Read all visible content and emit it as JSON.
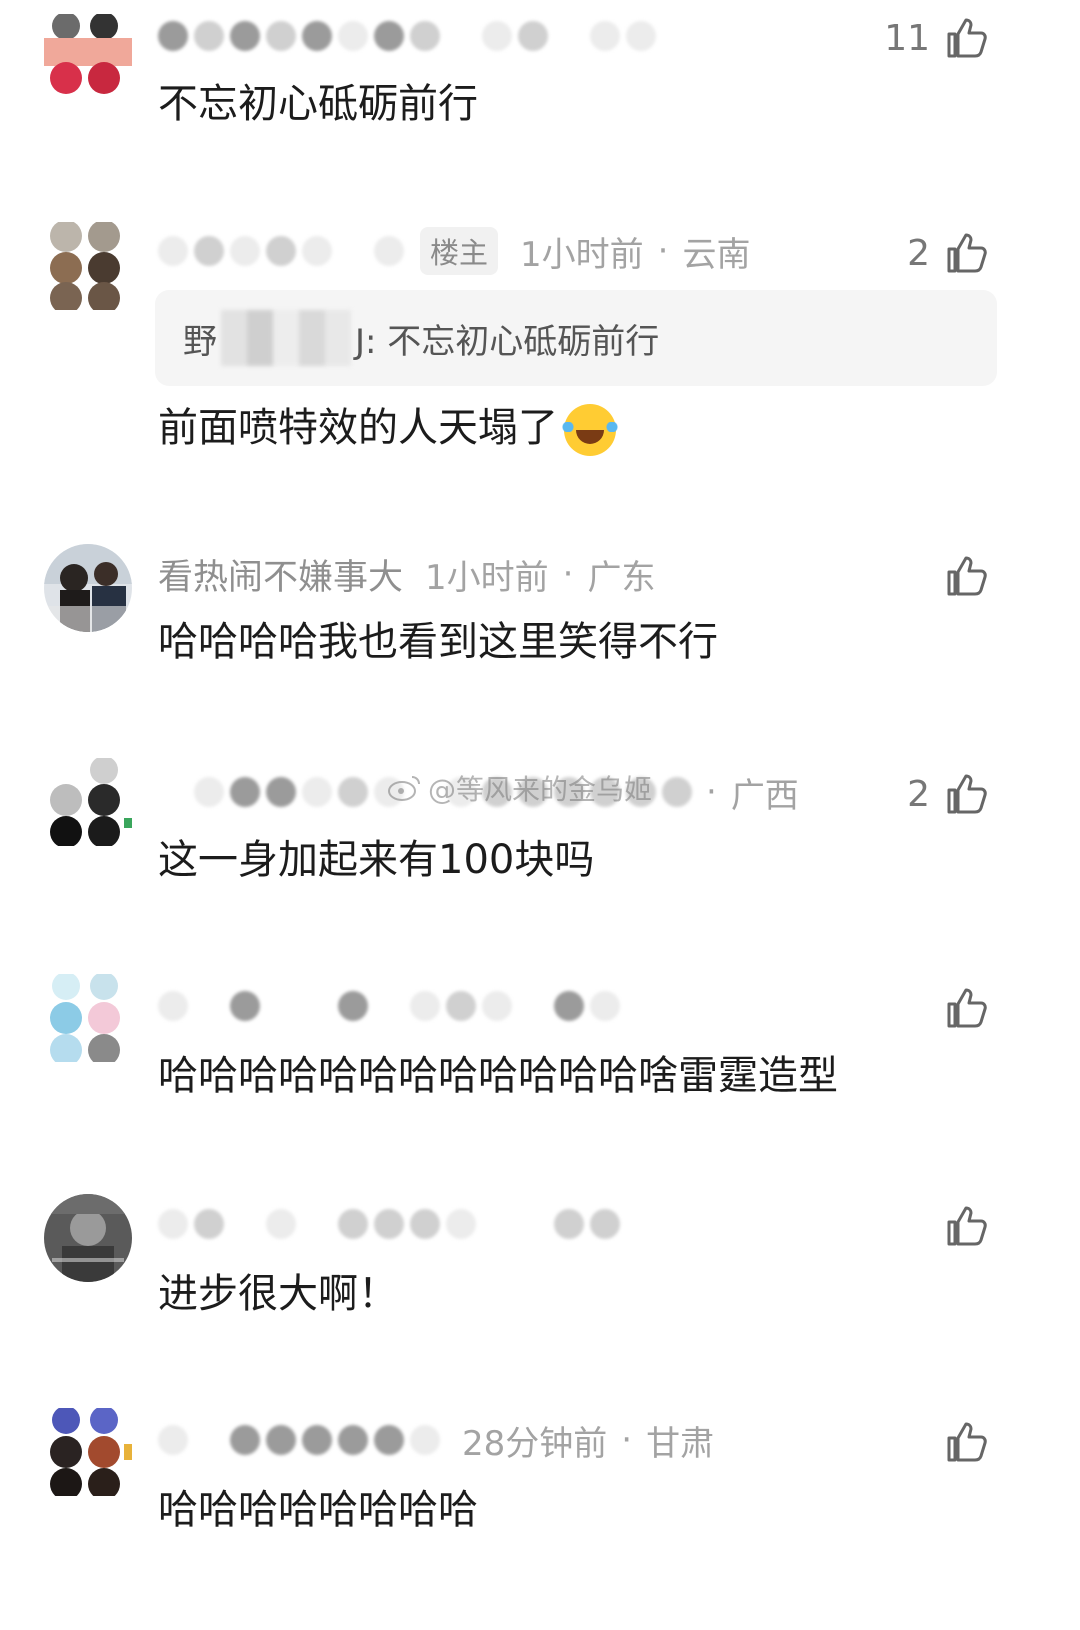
{
  "comments": [
    {
      "username": "",
      "badge": "",
      "time": "",
      "location": "",
      "text": "不忘初心砥砺前行",
      "likes": "11"
    },
    {
      "username": "",
      "badge": "楼主",
      "time": "1小时前",
      "location": "云南",
      "quote_prefix": "野",
      "quote_suffix": "J: 不忘初心砥砺前行",
      "text": "前面喷特效的人天塌了",
      "likes": "2"
    },
    {
      "username": "看热闹不嫌事大",
      "badge": "",
      "time": "1小时前",
      "location": "广东",
      "text": "哈哈哈哈我也看到这里笑得不行",
      "likes": ""
    },
    {
      "username": "",
      "badge": "",
      "time": "",
      "location": "广西",
      "text": "这一身加起来有100块吗",
      "likes": "2"
    },
    {
      "username": "",
      "badge": "",
      "time": "",
      "location": "",
      "text": "哈哈哈哈哈哈哈哈哈哈哈哈啥雷霆造型",
      "likes": ""
    },
    {
      "username": "",
      "badge": "",
      "time": "",
      "location": "",
      "text": "进步很大啊！",
      "likes": ""
    },
    {
      "username": "",
      "badge": "",
      "time": "28分钟前",
      "location": "甘肃",
      "text": "哈哈哈哈哈哈哈哈",
      "likes": ""
    }
  ],
  "separator": "·",
  "watermark": "@等风来的金乌姬",
  "icons": {
    "like": "thumbs-up-icon",
    "emoji": "tears-of-joy-emoji"
  },
  "colors": {
    "text": "#1c1c1c",
    "meta": "#a3a3a3",
    "quote_bg": "#f5f5f5"
  }
}
